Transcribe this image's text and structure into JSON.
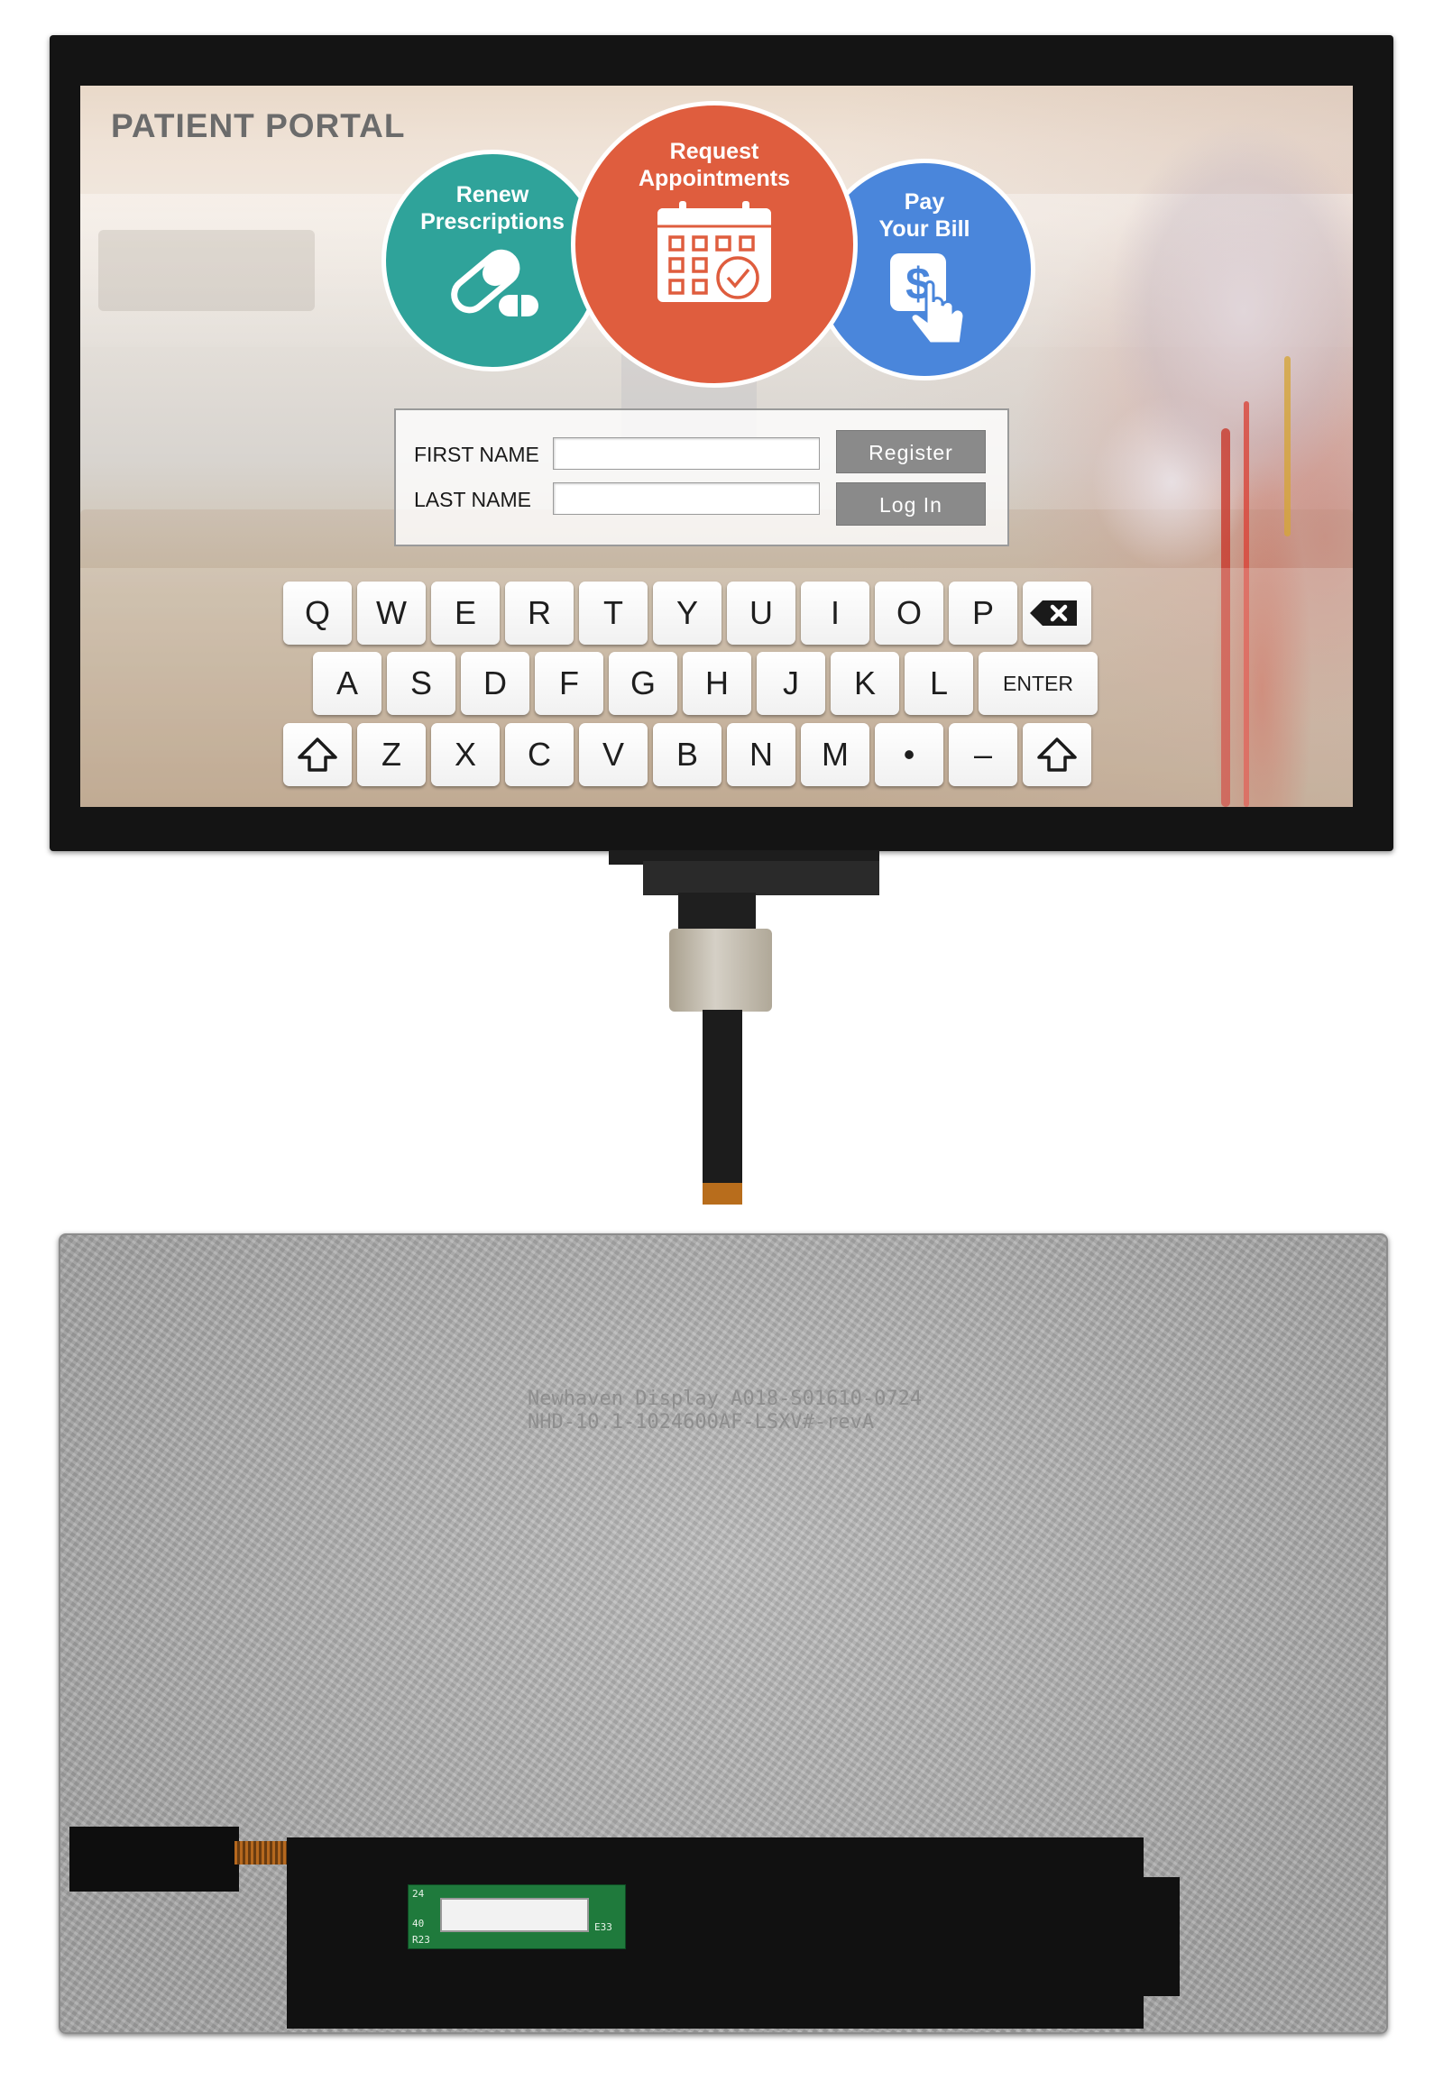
{
  "portal": {
    "title": "PATIENT PORTAL",
    "actions": [
      {
        "label_line1": "Renew",
        "label_line2": "Prescriptions",
        "icon": "pill-icon",
        "color": "#2fa39a"
      },
      {
        "label_line1": "Request",
        "label_line2": "Appointments",
        "icon": "calendar-check-icon",
        "color": "#df5d3e"
      },
      {
        "label_line1": "Pay",
        "label_line2": "Your Bill",
        "icon": "dollar-tap-icon",
        "color": "#4a86db"
      }
    ],
    "form": {
      "first_name_label": "FIRST NAME",
      "last_name_label": "LAST NAME",
      "first_name_value": "",
      "last_name_value": "",
      "register_label": "Register",
      "login_label": "Log In"
    }
  },
  "keyboard": {
    "row1": [
      "Q",
      "W",
      "E",
      "R",
      "T",
      "Y",
      "U",
      "I",
      "O",
      "P"
    ],
    "row2": [
      "A",
      "S",
      "D",
      "F",
      "G",
      "H",
      "J",
      "K",
      "L"
    ],
    "row3": [
      "Z",
      "X",
      "C",
      "V",
      "B",
      "N",
      "M",
      "•",
      "–"
    ],
    "enter_label": "ENTER",
    "backspace_icon": "backspace-icon",
    "shift_icon": "shift-arrow-icon"
  },
  "back_panel": {
    "silkscreen_line1": "Newhaven Display A018-S01610-0724",
    "silkscreen_line2": "NHD-10.1-1024600AF-LSXV#-revA",
    "pcb_labels": [
      "24",
      "40",
      "R23",
      "E33"
    ]
  }
}
